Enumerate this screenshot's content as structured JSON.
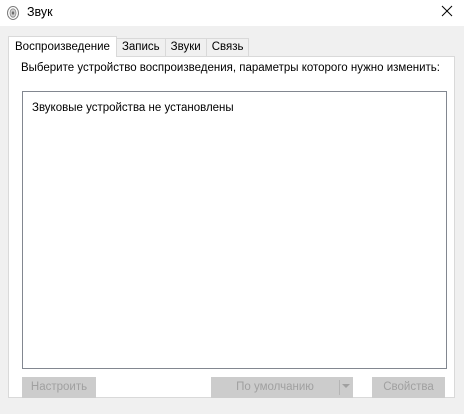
{
  "window": {
    "title": "Звук",
    "title_icon": "speaker-icon",
    "close_icon": "close-icon"
  },
  "tabs": [
    {
      "label": "Воспроизведение",
      "active": true
    },
    {
      "label": "Запись",
      "active": false
    },
    {
      "label": "Звуки",
      "active": false
    },
    {
      "label": "Связь",
      "active": false
    }
  ],
  "playback": {
    "instruction": "Выберите устройство воспроизведения, параметры которого нужно изменить:",
    "empty_message": "Звуковые устройства не установлены"
  },
  "buttons": {
    "configure": "Настроить",
    "set_default": "По умолчанию",
    "properties": "Свойства",
    "dropdown_icon": "chevron-down-icon"
  },
  "colors": {
    "client_background": "#f0f0f0",
    "panel_background": "#ffffff",
    "disabled_button": "#cccccc",
    "disabled_text": "#a0a0a0"
  }
}
